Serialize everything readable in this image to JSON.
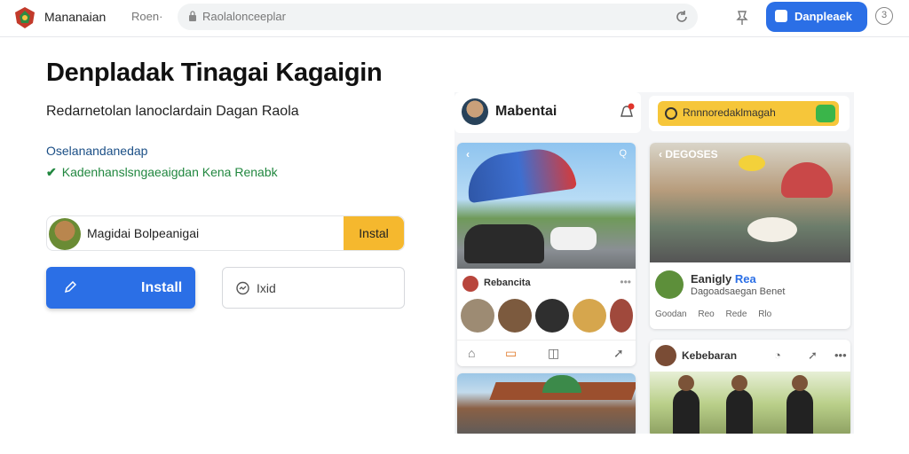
{
  "topbar": {
    "app_name": "Mananaian",
    "nav_link": "Roen·",
    "url": "Raolalonceeplar",
    "open_button": "Danpleaek",
    "help_glyph": "3"
  },
  "hero": {
    "headline": "Denpladak Tinagai Kagaigin",
    "subhead": "Redarnetolan lanoclardain Dagan Raola",
    "bullet1": "Oselanandanedap",
    "bullet2": "Kadenhanslsngaeaigdan Kena Renabk",
    "bullet2_icon": "check-icon"
  },
  "user_row": {
    "name": "Magidai Bolpeanigai",
    "install_label": "Instal"
  },
  "actions": {
    "install_label": "Install",
    "visit_label": "Ixid"
  },
  "preview": {
    "profile_title": "Mabentai",
    "search_text": "Rnnnoredaklmagah",
    "card1": {
      "post_name": "Rebancita",
      "back_glyph": "‹",
      "search_glyph": "Q"
    },
    "card2": {
      "overlay_text": "‹ DEGOSES",
      "name": "Eanigly",
      "name_suffix": "Rea",
      "subtitle": "Dagoadsaegan Benet",
      "stats": [
        "Goodan",
        "Reo",
        "Rede",
        "Rlo"
      ]
    },
    "card3": {
      "name": "Kebebaran"
    }
  },
  "colors": {
    "accent": "#2b6fe6",
    "install_small": "#f5b82e",
    "bullet_blue": "#1b4f86",
    "bullet_green": "#21873f",
    "search_yellow": "#f6c63a"
  }
}
